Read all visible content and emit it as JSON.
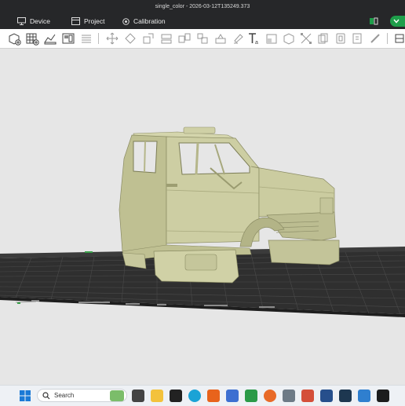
{
  "window": {
    "title": "single_color - 2026-03-12T135249.373"
  },
  "nav": {
    "tabs": [
      {
        "label": "Device",
        "icon": "monitor-icon"
      },
      {
        "label": "Project",
        "icon": "cube-icon"
      },
      {
        "label": "Calibration",
        "icon": "target-icon"
      }
    ]
  },
  "toolbar": {
    "tools": [
      "add-object-icon",
      "grid-plate-icon",
      "auto-orient-icon",
      "arrange-icon",
      "layers-icon",
      "move-icon",
      "rotate-icon",
      "scale-icon",
      "lay-on-face-icon",
      "cut-icon",
      "split-icon",
      "variable-height-icon",
      "paint-icon",
      "text-icon",
      "emboss-icon",
      "assembly-icon",
      "measure-icon",
      "copy-icon",
      "paste-icon",
      "ruler-icon",
      "more-icon"
    ]
  },
  "taskbar": {
    "search_placeholder": "Search",
    "apps": [
      "start-icon",
      "file-manager-icon",
      "folder-icon",
      "terminal-icon",
      "edge-icon",
      "office-icon",
      "slicer-icon",
      "app-green-icon",
      "firefox-icon",
      "calculator-icon",
      "paint-app-icon",
      "app-blue-icon",
      "app-dark-icon",
      "photos-icon",
      "bambu-icon"
    ]
  },
  "colors": {
    "accent_green": "#1e9e4a",
    "model": "#c9caa0",
    "plate": "#2b2b2b"
  }
}
